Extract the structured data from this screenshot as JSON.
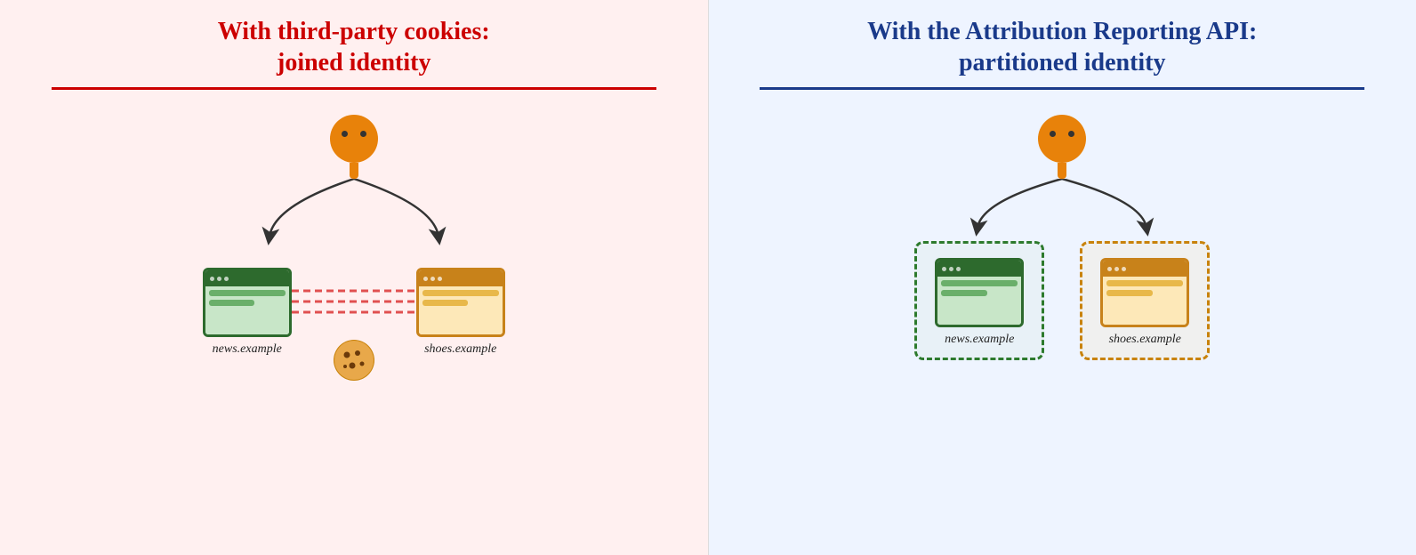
{
  "left": {
    "title_line1": "With third-party cookies:",
    "title_line2": "joined identity",
    "site1": "news.example",
    "site2": "shoes.example"
  },
  "right": {
    "title_line1": "With the Attribution Reporting API:",
    "title_line2": "partitioned identity",
    "site1": "news.example",
    "site2": "shoes.example"
  }
}
